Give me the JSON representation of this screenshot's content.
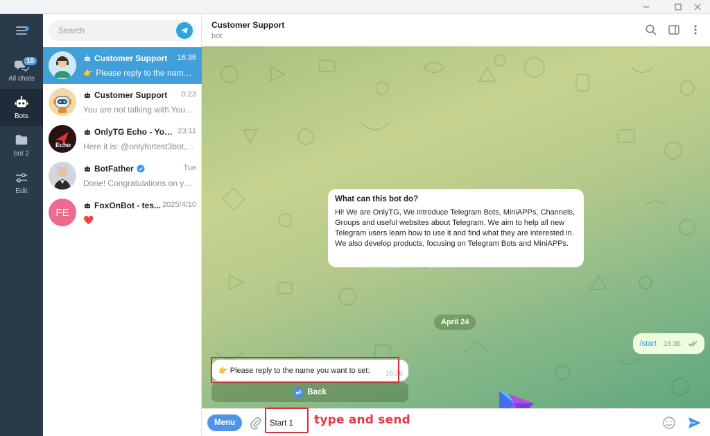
{
  "window": {
    "controls": [
      "minimize",
      "maximize",
      "close"
    ]
  },
  "rail": {
    "items": [
      {
        "label": "All chats",
        "badge": "10",
        "icon": "chats-icon"
      },
      {
        "label": "Bots",
        "icon": "bot-icon",
        "active": true
      },
      {
        "label": "bot 2",
        "icon": "folder-icon"
      },
      {
        "label": "Edit",
        "icon": "sliders-icon"
      }
    ]
  },
  "search": {
    "placeholder": "Search"
  },
  "chats": [
    {
      "title": "Customer Support",
      "time": "16:36",
      "preview": "👉 Please reply to the name you want to set:",
      "active": true
    },
    {
      "title": "Customer Support",
      "time": "0:23",
      "preview": "You are not talking with Yoursupport"
    },
    {
      "title": "OnlyTG Echo - Your ...",
      "time": "23:11",
      "preview": "Here it is: @onlyfortest3bot, enjoy",
      "avatar_text": "Echo"
    },
    {
      "title": "BotFather",
      "time": "Tue",
      "preview": "Done! Congratulations on your new bot",
      "verified": true
    },
    {
      "title": "FoxOnBot - tes...",
      "time": "2025/4/10",
      "preview": "❤️",
      "avatar_text": "FE"
    }
  ],
  "header": {
    "title": "Customer Support",
    "subtitle": "bot"
  },
  "intro": {
    "title": "What can this bot do?",
    "body": "Hi! We are OnlyTG, We introduce Telegram Bots, MiniAPPs, Channels, Groups and useful websites about Telegram. We aim to help all new Telegram users learn how to use it and find what they are interested in. We also develop products, focusing on Telegram Bots and MiniAPPs."
  },
  "date_separator": "April 24",
  "outgoing": {
    "text": "/start",
    "time": "16:36"
  },
  "incoming": {
    "text": "👉 Please reply to the name you want to set:",
    "time": "16:36"
  },
  "keyboard": {
    "button": "Back"
  },
  "composer": {
    "menu_label": "Menu",
    "input_value": "Start 1",
    "annotation": "type and send"
  },
  "colors": {
    "accent": "#419fd9",
    "rail": "#2b3a4a",
    "highlight": "#d62f3a"
  }
}
